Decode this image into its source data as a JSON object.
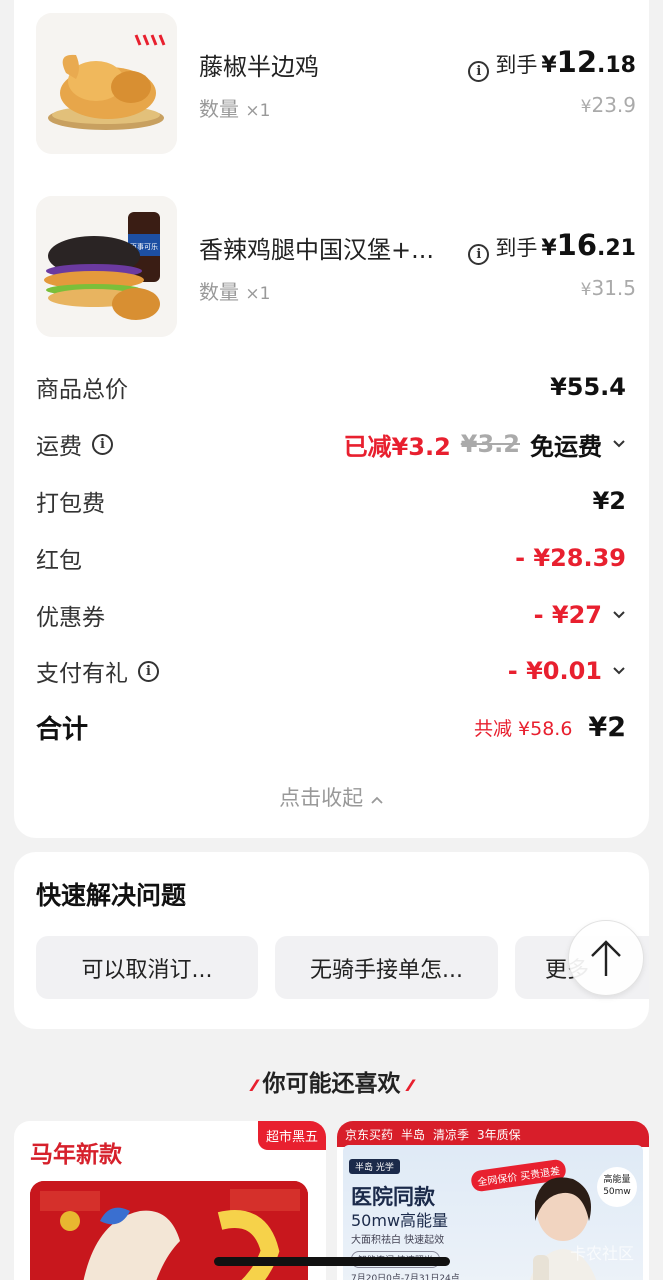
{
  "items": [
    {
      "name": "藤椒半边鸡",
      "qty_label": "数量",
      "qty_value": "×1",
      "receive_label": "到手",
      "price_currency": "¥",
      "price_int": "12",
      "price_dec": ".18",
      "orig_currency": "¥",
      "orig_price": "23.9"
    },
    {
      "name": "香辣鸡腿中国汉堡+...",
      "qty_label": "数量",
      "qty_value": "×1",
      "receive_label": "到手",
      "price_currency": "¥",
      "price_int": "16",
      "price_dec": ".21",
      "orig_currency": "¥",
      "orig_price": "31.5",
      "drink_label": "百事可乐"
    }
  ],
  "summary": {
    "goods_total_label": "商品总价",
    "goods_total_value": "¥55.4",
    "shipping_label": "运费",
    "shipping_reduced": "已减¥3.2",
    "shipping_orig": "¥3.2",
    "shipping_free": "免运费",
    "packing_label": "打包费",
    "packing_value": "¥2",
    "hongbao_label": "红包",
    "hongbao_value": "- ¥28.39",
    "coupon_label": "优惠券",
    "coupon_value": "- ¥27",
    "pay_gift_label": "支付有礼",
    "pay_gift_value": "- ¥0.01",
    "total_label": "合计",
    "total_saved": "共减 ¥58.6",
    "total_value": "¥2",
    "collapse_label": "点击收起"
  },
  "quick": {
    "title": "快速解决问题",
    "chips": [
      "可以取消订...",
      "无骑手接单怎...",
      "更多"
    ]
  },
  "recommend": {
    "title": "你可能还喜欢",
    "left": {
      "title": "马年新款",
      "tag": "超市黑五"
    },
    "right": {
      "bar": [
        "京东买药",
        "半岛",
        "清凉季",
        "3年质保"
      ],
      "tag": "半岛 光学",
      "badge": "全网保价 买贵退差",
      "h1": "医院同款",
      "h2": "50mw高能量",
      "sub": "大面积祛白 快速起效",
      "pill": "智能连闪 快速照光",
      "date": "7月20日0点-7月31日24点",
      "cap": "高能量 50mw"
    }
  },
  "watermark": "卡农社区",
  "colors": {
    "accent_red": "#e8202f",
    "muted": "#999999"
  }
}
